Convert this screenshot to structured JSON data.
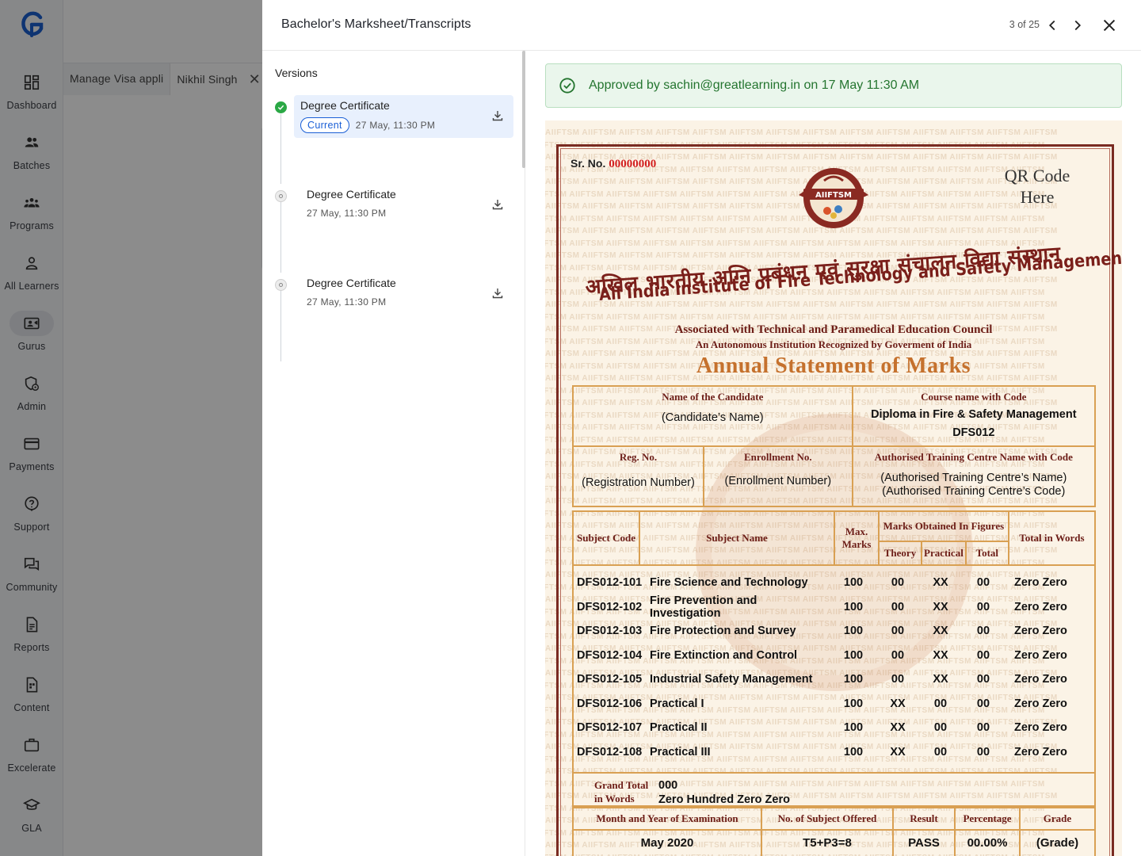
{
  "nav": {
    "items": [
      {
        "label": "Dashboard",
        "icon": "dashboard-icon"
      },
      {
        "label": "Batches",
        "icon": "batches-icon"
      },
      {
        "label": "Programs",
        "icon": "programs-icon"
      },
      {
        "label": "All Learners",
        "icon": "learner-icon"
      },
      {
        "label": "Gurus",
        "icon": "gurus-icon"
      },
      {
        "label": "Admin",
        "icon": "admin-icon"
      },
      {
        "label": "Payments",
        "icon": "card-icon"
      },
      {
        "label": "Support",
        "icon": "support-icon"
      },
      {
        "label": "Community",
        "icon": "chat-icon"
      },
      {
        "label": "Reports",
        "icon": "report-icon"
      },
      {
        "label": "Content",
        "icon": "content-icon"
      },
      {
        "label": "Excelerate",
        "icon": "briefcase-icon"
      },
      {
        "label": "GLA",
        "icon": "graduation-icon"
      }
    ],
    "active_index": 4
  },
  "background": {
    "tabs": [
      "Manage Visa appli",
      "Nikhil Singh"
    ]
  },
  "drawer": {
    "title": "Bachelor's Marksheet/Transcripts",
    "pager": "3 of 25"
  },
  "versions": {
    "title": "Versions",
    "items": [
      {
        "name": "Degree Certificate",
        "badge": "Current",
        "date": "27 May, 11:30 PM"
      },
      {
        "name": "Degree Certificate",
        "date": "27 May, 11:30 PM"
      },
      {
        "name": "Degree Certificate",
        "date": "27 May, 11:30 PM"
      }
    ]
  },
  "approval": {
    "text": "Approved by sachin@greatlearning.in on 17 May 11:30 AM",
    "color": "#24752f"
  },
  "certificate": {
    "watermark": "AIIFTSM",
    "sr_label": "Sr. No.",
    "sr_value": "00000000",
    "qr_line1": "QR Code",
    "qr_line2": "Here",
    "seal_text": "AIIFTSM",
    "hindi_name": "अखिल भारतीय अग्नि प्रबंधन एवं सुरक्षा संचालन विद्या संस्थान",
    "institute": "All India Institute of Fire Technology and Safety Management",
    "associated": "Associated with Technical and Paramedical Education Council",
    "autonomous": "An Autonomous Institution Recognized by Goverment of India",
    "heading": "Annual Statement of Marks",
    "candidate_caption": "Name of the Candidate",
    "candidate_value": "(Candidate’s Name)",
    "course_caption": "Course name with Code",
    "course_value": "Diploma in Fire & Safety Management",
    "course_code": "DFS012",
    "reg_caption": "Reg. No.",
    "reg_value": "(Registration Number)",
    "enroll_caption": "Enrollment No.",
    "enroll_value": "(Enrollment Number)",
    "atc_caption": "Authorised Training Centre Name with Code",
    "atc_name": "(Authorised Training Centre’s Name)",
    "atc_code": "(Authorised Training Centre’s Code)",
    "col_code": "Subject Code",
    "col_name": "Subject Name",
    "col_max": "Max. Marks",
    "col_obtained": "Marks Obtained In Figures",
    "col_theory": "Theory",
    "col_practical": "Practical",
    "col_total": "Total",
    "col_words": "Total in Words",
    "subjects": [
      {
        "code": "DFS012-101",
        "name": "Fire Science and Technology",
        "max": "100",
        "theory": "00",
        "practical": "XX",
        "total": "00",
        "words": "Zero Zero"
      },
      {
        "code": "DFS012-102",
        "name": "Fire Prevention and Investigation",
        "max": "100",
        "theory": "00",
        "practical": "XX",
        "total": "00",
        "words": "Zero Zero"
      },
      {
        "code": "DFS012-103",
        "name": "Fire Protection and Survey",
        "max": "100",
        "theory": "00",
        "practical": "XX",
        "total": "00",
        "words": "Zero Zero"
      },
      {
        "code": "DFS012-104",
        "name": "Fire Extinction and Control",
        "max": "100",
        "theory": "00",
        "practical": "XX",
        "total": "00",
        "words": "Zero Zero"
      },
      {
        "code": "DFS012-105",
        "name": "Industrial Safety Management",
        "max": "100",
        "theory": "00",
        "practical": "XX",
        "total": "00",
        "words": "Zero Zero"
      },
      {
        "code": "DFS012-106",
        "name": "Practical I",
        "max": "100",
        "theory": "XX",
        "practical": "00",
        "total": "00",
        "words": "Zero Zero"
      },
      {
        "code": "DFS012-107",
        "name": "Practical II",
        "max": "100",
        "theory": "XX",
        "practical": "00",
        "total": "00",
        "words": "Zero Zero"
      },
      {
        "code": "DFS012-108",
        "name": "Practical III",
        "max": "100",
        "theory": "XX",
        "practical": "00",
        "total": "00",
        "words": "Zero Zero"
      }
    ],
    "grand_total_label_1": "Grand Total",
    "grand_total_label_2": "in Words",
    "grand_total_value": "000",
    "grand_total_words": "Zero Hundred Zero Zero",
    "f_month_caption": "Month and Year of Examination",
    "f_month_value": "May 2020",
    "f_subjects_caption": "No. of Subject Offered",
    "f_subjects_value": "T5+P3=8",
    "f_result_caption": "Result",
    "f_result_value": "PASS",
    "f_percent_caption": "Percentage",
    "f_percent_value": "00.00%",
    "f_grade_caption": "Grade",
    "f_grade_value": "(Grade)"
  }
}
